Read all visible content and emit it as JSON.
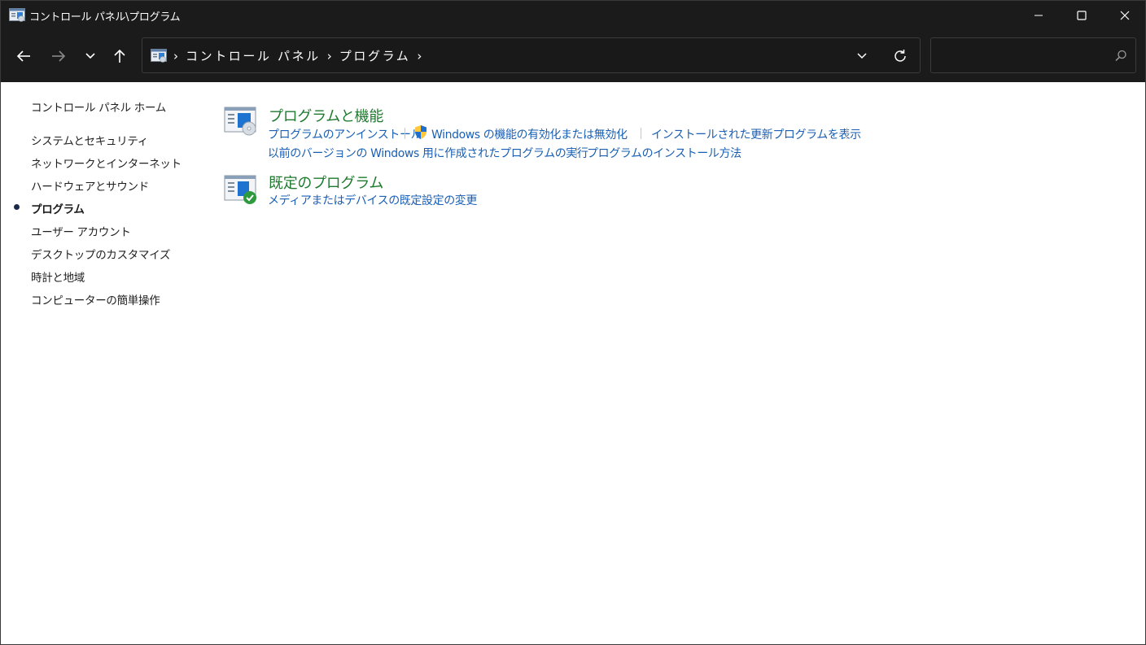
{
  "window": {
    "title": "コントロール パネル\\プログラム",
    "icon": "control-panel-icon"
  },
  "nav": {
    "back_icon": "arrow-left-icon",
    "forward_icon": "arrow-right-icon",
    "recent_icon": "chevron-down-icon",
    "up_icon": "arrow-up-icon"
  },
  "address": {
    "crumbs": [
      "コントロール パネル",
      "プログラム"
    ],
    "separator": "›"
  },
  "search": {
    "value": "",
    "placeholder": ""
  },
  "sidebar": {
    "items": [
      {
        "label": "コントロール パネル ホーム",
        "active": false
      },
      {
        "label": "システムとセキュリティ",
        "active": false
      },
      {
        "label": "ネットワークとインターネット",
        "active": false
      },
      {
        "label": "ハードウェアとサウンド",
        "active": false
      },
      {
        "label": "プログラム",
        "active": true
      },
      {
        "label": "ユーザー アカウント",
        "active": false
      },
      {
        "label": "デスクトップのカスタマイズ",
        "active": false
      },
      {
        "label": "時計と地域",
        "active": false
      },
      {
        "label": "コンピューターの簡単操作",
        "active": false
      }
    ]
  },
  "sections": {
    "programs_features": {
      "title": "プログラムと機能",
      "icon": "programs-features-icon",
      "links": {
        "uninstall": "プログラムのアンインストール",
        "windows_features": "Windows の機能の有効化または無効化",
        "installed_updates": "インストールされた更新プログラムを表示",
        "compatibility": "以前のバージョンの Windows 用に作成されたプログラムの実行",
        "how_to_install": "プログラムのインストール方法"
      }
    },
    "default_programs": {
      "title": "既定のプログラム",
      "icon": "default-programs-icon",
      "links": {
        "change_defaults": "メディアまたはデバイスの既定設定の変更"
      }
    }
  },
  "colors": {
    "titlebar": "#1b1b1b",
    "section_title": "#1e7a2e",
    "link": "#1a5fb4"
  }
}
